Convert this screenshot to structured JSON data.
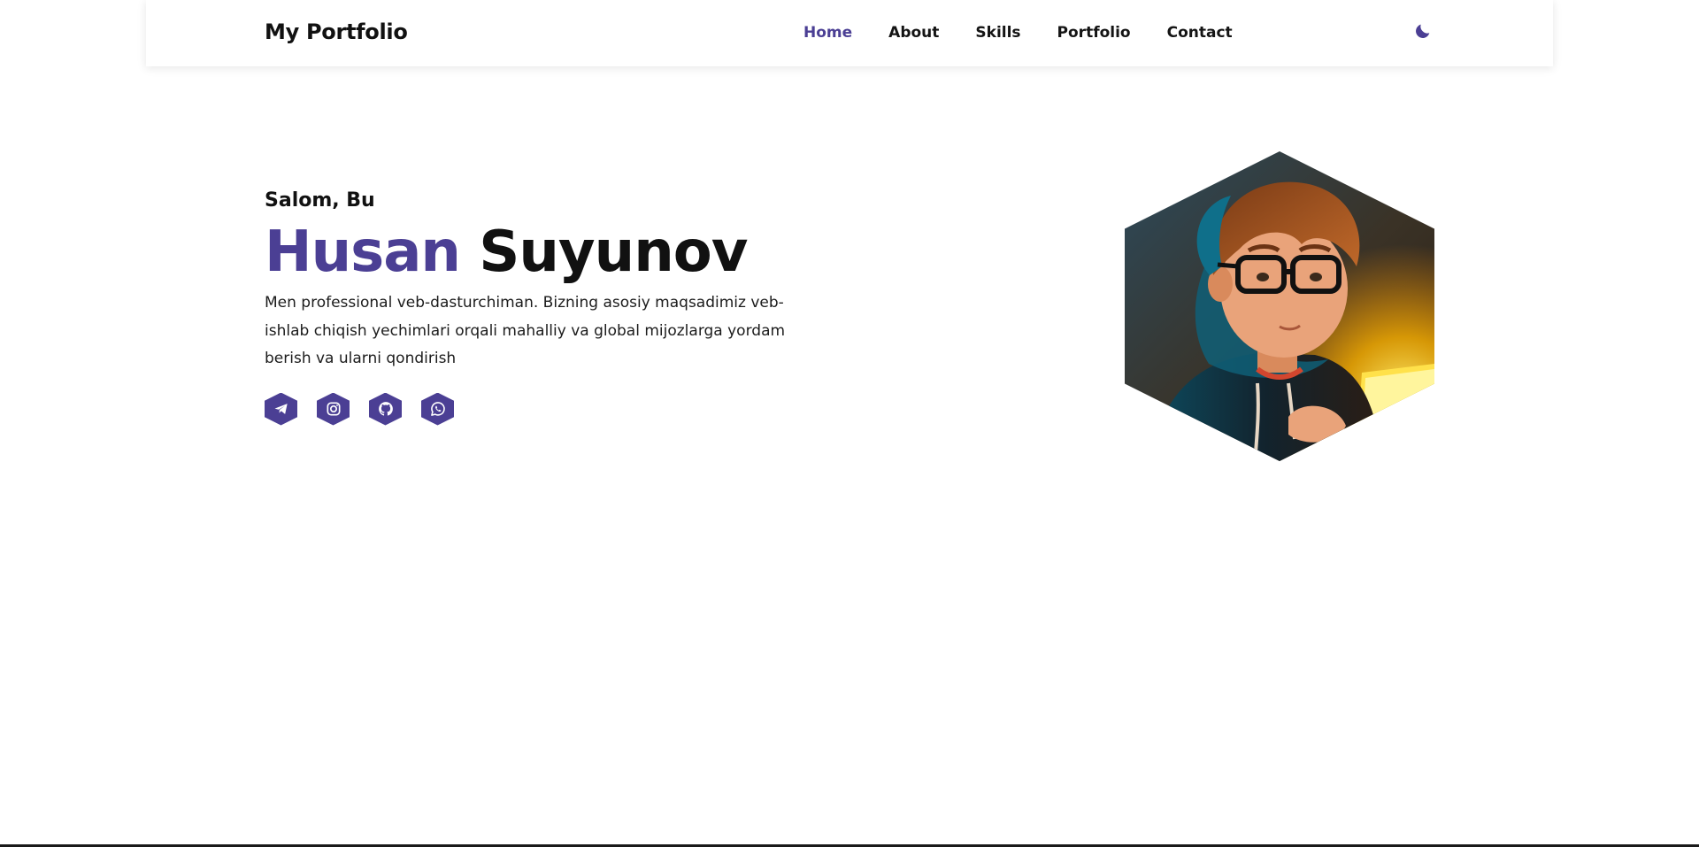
{
  "navbar": {
    "logo": "My Portfolio",
    "links": [
      {
        "label": "Home",
        "active": true
      },
      {
        "label": "About"
      },
      {
        "label": "Skills"
      },
      {
        "label": "Portfolio"
      },
      {
        "label": "Contact"
      }
    ],
    "theme_icon": "moon-icon"
  },
  "hero": {
    "greeting": "Salom, Bu",
    "first_name": "Husan",
    "last_name": "Suyunov",
    "description": "Men professional veb-dasturchiman. Bizning asosiy maqsadimiz veb-ishlab chiqish yechimlari orqali mahalliy va global mijozlarga yordam berish va ularni qondirish",
    "socials": [
      {
        "icon": "telegram-icon"
      },
      {
        "icon": "instagram-icon"
      },
      {
        "icon": "github-icon"
      },
      {
        "icon": "whatsapp-icon"
      }
    ]
  },
  "colors": {
    "accent": "#4b3f94",
    "text": "#111111"
  }
}
